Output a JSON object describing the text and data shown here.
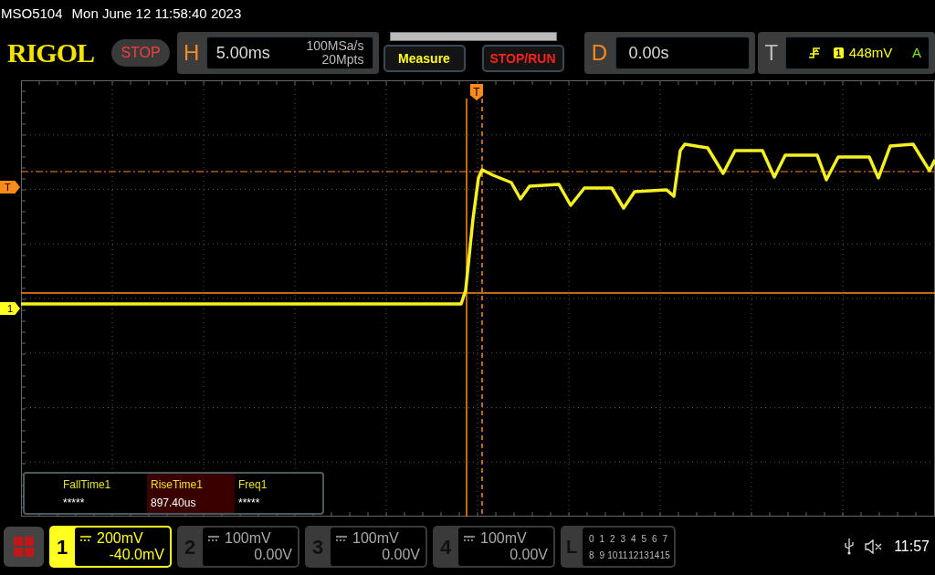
{
  "header": {
    "model": "MSO5104",
    "datetime": "Mon June 12 11:58:40 2023"
  },
  "logo": "RIGOL",
  "run_state": {
    "label": "STOP",
    "kind": "stop"
  },
  "horizontal": {
    "label": "H",
    "timebase": "5.00ms",
    "sample_rate": "100MSa/s",
    "memory": "20Mpts"
  },
  "buttons": [
    {
      "label": "Measure",
      "kind": "measure"
    },
    {
      "label": "STOP/RUN",
      "kind": "run"
    }
  ],
  "delay": {
    "label": "D",
    "value": "0.00s"
  },
  "trigger": {
    "label": "T",
    "source": "1",
    "level": "448mV",
    "mode": "A"
  },
  "markers": {
    "trigger_position": "T",
    "trigger_level": "T",
    "channel": "1"
  },
  "measurements": [
    {
      "label": "FallTime1",
      "value": "*****",
      "selected": false
    },
    {
      "label": "RiseTime1",
      "value": "897.40us",
      "selected": true
    },
    {
      "label": "Freq1",
      "value": "*****",
      "selected": false
    }
  ],
  "channels": [
    {
      "number": "1",
      "scale": "200mV",
      "offset": "-40.0mV",
      "selected": true
    },
    {
      "number": "2",
      "scale": "100mV",
      "offset": "0.00V",
      "selected": false
    },
    {
      "number": "3",
      "scale": "100mV",
      "offset": "0.00V",
      "selected": false
    },
    {
      "number": "4",
      "scale": "100mV",
      "offset": "0.00V",
      "selected": false
    }
  ],
  "logic": {
    "label": "L",
    "bits": [
      "0",
      "1",
      "2",
      "3",
      "4",
      "5",
      "6",
      "7",
      "8",
      "9",
      "10",
      "11",
      "12",
      "13",
      "14",
      "15"
    ]
  },
  "status": {
    "time": "11:57"
  }
}
